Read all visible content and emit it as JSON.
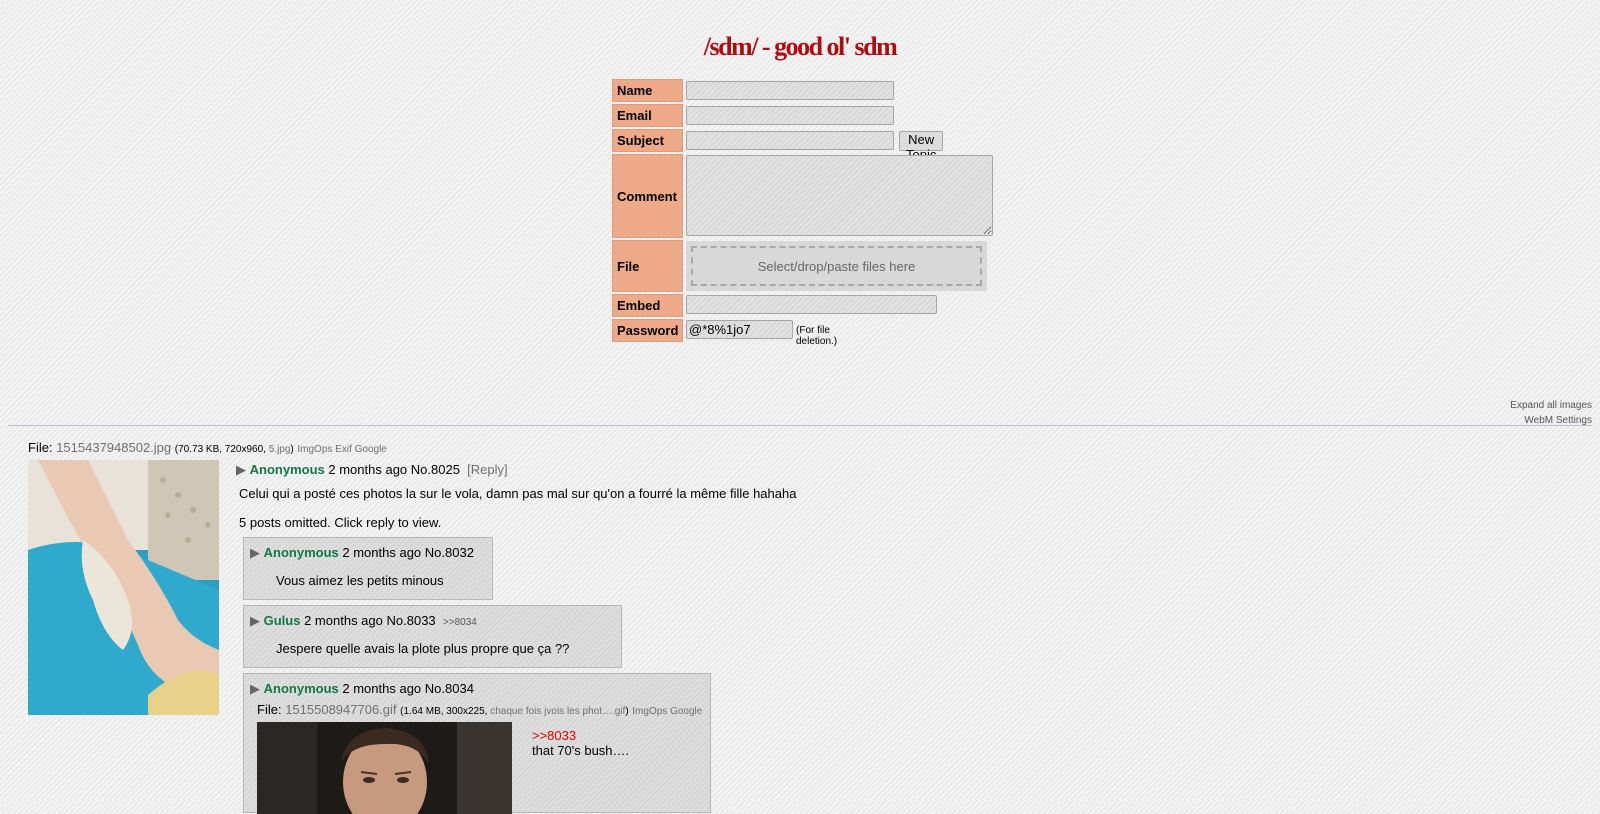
{
  "board": {
    "title": "/sdm/ - good ol' sdm"
  },
  "form": {
    "name_label": "Name",
    "email_label": "Email",
    "subject_label": "Subject",
    "new_topic_button": "New Topic",
    "comment_label": "Comment",
    "file_label": "File",
    "dropzone_text": "Select/drop/paste files here",
    "embed_label": "Embed",
    "password_label": "Password",
    "password_value": "@*8%1jo7",
    "password_hint": "(For file deletion.)"
  },
  "options": {
    "expand_images": "Expand all images",
    "webm_settings": "WebM Settings"
  },
  "thread": {
    "file_prefix": "File:",
    "file_name": "1515437948502.jpg",
    "file_meta_open": "(",
    "file_meta": "70.73 KB, 720x960, ",
    "file_alias": "5.jpg",
    "file_meta_close": ")",
    "file_tools": "ImgOps Exif Google",
    "op": {
      "arrow": "▶",
      "name": "Anonymous",
      "time": "2 months ago",
      "number": "No.8025",
      "reply_link": "[Reply]",
      "comment": "Celui qui a posté ces photos la sur le vola, damn pas mal sur qu'on a fourré la même fille hahaha",
      "omitted": "5 posts omitted. Click reply to view."
    },
    "replies": [
      {
        "arrow": "▶",
        "name": "Anonymous",
        "time": "2 months ago",
        "number": "No.8032",
        "backlink": "",
        "comment": "Vous aimez les petits minous"
      },
      {
        "arrow": "▶",
        "name": "Gulus",
        "time": "2 months ago",
        "number": "No.8033",
        "backlink": ">>8034",
        "comment": "Jespere quelle avais la plote plus propre que ça ??"
      },
      {
        "arrow": "▶",
        "name": "Anonymous",
        "time": "2 months ago",
        "number": "No.8034",
        "file_prefix": "File:",
        "file_name": "1515508947706.gif",
        "file_meta_open": "(",
        "file_meta": "1.64 MB, 300x225, ",
        "file_alias": "chaque fois jvois les phot….gif",
        "file_meta_close": ")",
        "file_tools": "ImgOps Google",
        "quote": ">>8033",
        "comment": "that 70's bush…."
      }
    ]
  }
}
